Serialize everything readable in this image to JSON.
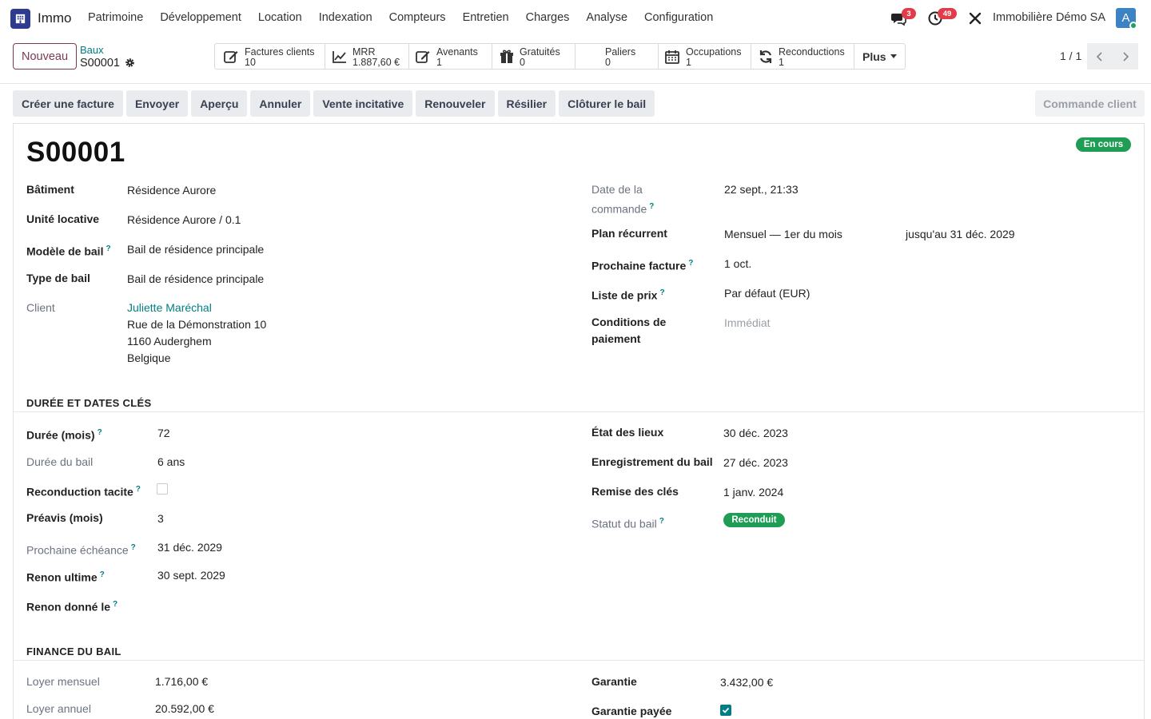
{
  "app": {
    "name": "Immo",
    "icon": "building-icon"
  },
  "menu": [
    "Patrimoine",
    "Développement",
    "Location",
    "Indexation",
    "Compteurs",
    "Entretien",
    "Charges",
    "Analyse",
    "Configuration"
  ],
  "systray": {
    "messages_count": "3",
    "activities_count": "49",
    "company": "Immobilière Démo SA",
    "avatar_letter": "A"
  },
  "control": {
    "new_label": "Nouveau",
    "breadcrumb_parent": "Baux",
    "breadcrumb_current": "S00001",
    "pager": "1 / 1"
  },
  "smart_buttons": [
    {
      "icon": "edit-icon",
      "label": "Factures clients",
      "value": "10"
    },
    {
      "icon": "chart-line-icon",
      "label": "MRR",
      "value": "1.887,60 €"
    },
    {
      "icon": "edit-icon",
      "label": "Avenants",
      "value": "1"
    },
    {
      "icon": "gift-icon",
      "label": "Gratuités",
      "value": "0"
    },
    {
      "icon": "",
      "label": "Paliers",
      "value": "0"
    },
    {
      "icon": "calendar-icon",
      "label": "Occupations",
      "value": "1"
    },
    {
      "icon": "refresh-icon",
      "label": "Reconductions",
      "value": "1"
    }
  ],
  "smart_more": "Plus",
  "actions": [
    "Créer une facture",
    "Envoyer",
    "Aperçu",
    "Annuler",
    "Vente incitative",
    "Renouveler",
    "Résilier",
    "Clôturer le bail"
  ],
  "action_right": "Commande client",
  "record": {
    "name": "S00001",
    "state": "En cours",
    "left": {
      "batiment_label": "Bâtiment",
      "batiment": "Résidence Aurore",
      "unite_label": "Unité locative",
      "unite": "Résidence Aurore / 0.1",
      "modele_label": "Modèle de bail",
      "modele": "Bail de résidence principale",
      "type_label": "Type de bail",
      "type": "Bail de résidence principale",
      "client_label": "Client",
      "client_name": "Juliette Maréchal",
      "client_street": "Rue de la Démonstration 10",
      "client_city": "1160 Auderghem",
      "client_country": "Belgique"
    },
    "right": {
      "date_label_1": "Date de la",
      "date_label_2": "commande",
      "date": "22 sept., 21:33",
      "plan_label": "Plan récurrent",
      "plan": "Mensuel — 1er du mois",
      "plan_until": "jusqu'au  31 déc. 2029",
      "next_invoice_label": "Prochaine facture",
      "next_invoice": "1 oct.",
      "pricelist_label": "Liste de prix",
      "pricelist": "Par défaut (EUR)",
      "terms_label_1": "Conditions de",
      "terms_label_2": "paiement",
      "terms": "Immédiat"
    }
  },
  "duration_section": {
    "title": "DURÉE ET DATES CLÉS",
    "duree_mois_label": "Durée (mois)",
    "duree_mois": "72",
    "duree_bail_label": "Durée du bail",
    "duree_bail": "6 ans",
    "reconduction_label": "Reconduction tacite",
    "reconduction_checked": false,
    "preavis_label": "Préavis (mois)",
    "preavis": "3",
    "echeance_label": "Prochaine échéance",
    "echeance": "31 déc. 2029",
    "renon_ultime_label": "Renon ultime",
    "renon_ultime": "30 sept. 2029",
    "renon_donne_label": "Renon donné le",
    "renon_donne": "",
    "etat_lieux_label": "État des lieux",
    "etat_lieux": "30 déc. 2023",
    "enregistrement_label": "Enregistrement du bail",
    "enregistrement": "27 déc. 2023",
    "remise_cles_label": "Remise des clés",
    "remise_cles": "1 janv. 2024",
    "statut_label": "Statut du bail",
    "statut": "Reconduit"
  },
  "finance_section": {
    "title": "FINANCE DU BAIL",
    "loyer_mensuel_label": "Loyer mensuel",
    "loyer_mensuel": "1.716,00 €",
    "loyer_annuel_label": "Loyer annuel",
    "loyer_annuel": "20.592,00 €",
    "garantie_label": "Garantie",
    "garantie": "3.432,00 €",
    "garantie_payee_label": "Garantie payée",
    "garantie_payee_checked": true
  },
  "colors": {
    "brand": "#7a3a55",
    "link": "#017e84",
    "success": "#1f9d55",
    "badge": "#e23b4a",
    "app": "#2f3b8f"
  }
}
